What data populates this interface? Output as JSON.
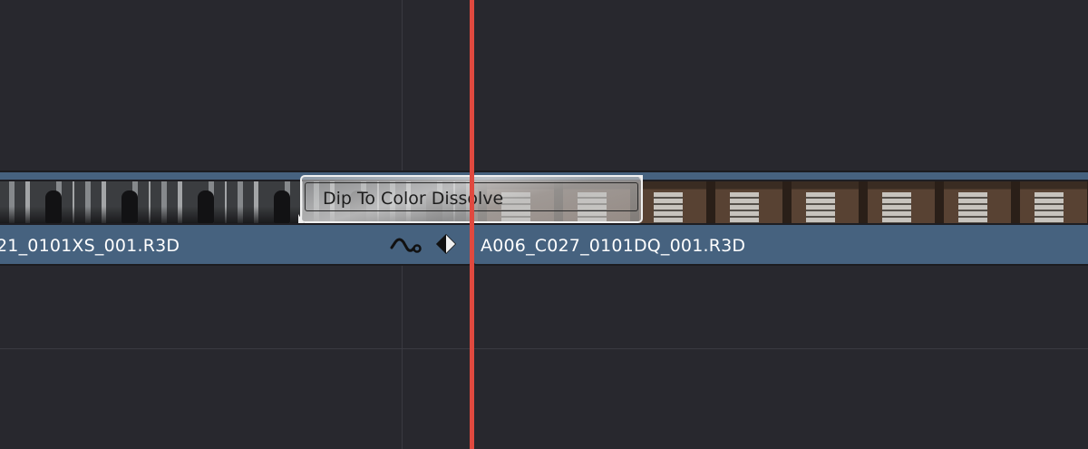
{
  "clips": [
    {
      "name": "21_0101XS_001.R3D",
      "thumbnail_icon": "dark-corridor-figure-thumbnail"
    },
    {
      "name": "A006_C027_0101DQ_001.R3D",
      "thumbnail_icon": "interior-sign-thumbnail"
    }
  ],
  "transition": {
    "label": "Dip To Color Dissolve"
  },
  "clip_icons": {
    "curve_icon": "curve-icon",
    "keyframe_icon": "keyframe-diamond-icon"
  },
  "colors": {
    "background": "#28282e",
    "clip": "#46627f",
    "playhead": "#e0493f",
    "transition_border": "#f0f0f0"
  }
}
